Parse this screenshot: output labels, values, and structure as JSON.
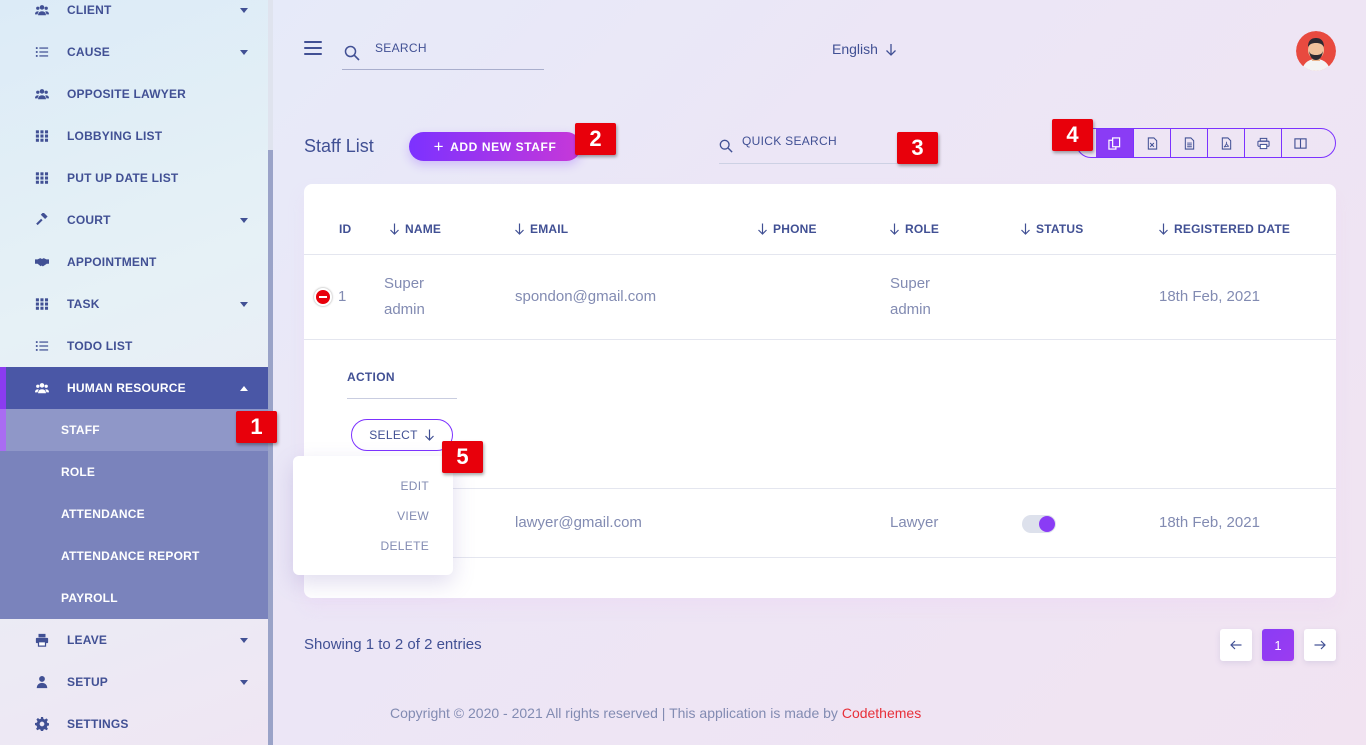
{
  "sidebar": {
    "items": [
      {
        "label": "CLIENT",
        "icon": "users-icon",
        "has_caret": true
      },
      {
        "label": "CAUSE",
        "icon": "list-icon",
        "has_caret": true
      },
      {
        "label": "OPPOSITE LAWYER",
        "icon": "users-icon",
        "has_caret": false
      },
      {
        "label": "LOBBYING LIST",
        "icon": "grid-icon",
        "has_caret": false
      },
      {
        "label": "PUT UP DATE LIST",
        "icon": "grid-icon",
        "has_caret": false
      },
      {
        "label": "COURT",
        "icon": "gavel-icon",
        "has_caret": true
      },
      {
        "label": "APPOINTMENT",
        "icon": "handshake-icon",
        "has_caret": false
      },
      {
        "label": "TASK",
        "icon": "grid-icon",
        "has_caret": true
      },
      {
        "label": "TODO LIST",
        "icon": "list-icon",
        "has_caret": false
      },
      {
        "label": "HUMAN RESOURCE",
        "icon": "users-icon",
        "has_caret": true,
        "active": true
      },
      {
        "label": "LEAVE",
        "icon": "printer-icon",
        "has_caret": true
      },
      {
        "label": "SETUP",
        "icon": "user-icon",
        "has_caret": true
      },
      {
        "label": "SETTINGS",
        "icon": "gear-icon",
        "has_caret": false
      }
    ],
    "subitems": [
      {
        "label": "STAFF",
        "active": true
      },
      {
        "label": "ROLE"
      },
      {
        "label": "ATTENDANCE"
      },
      {
        "label": "ATTENDANCE REPORT"
      },
      {
        "label": "PAYROLL"
      }
    ]
  },
  "markers": [
    "1",
    "2",
    "3",
    "4",
    "5"
  ],
  "header": {
    "search_placeholder": "SEARCH",
    "language": "English"
  },
  "page": {
    "title": "Staff List",
    "add_button": "ADD NEW STAFF",
    "quick_search_placeholder": "QUICK SEARCH",
    "export_buttons": [
      "copy-icon",
      "excel-icon",
      "csv-icon",
      "pdf-icon",
      "print-icon",
      "columns-icon"
    ]
  },
  "table": {
    "columns": [
      "ID",
      "NAME",
      "EMAIL",
      "PHONE",
      "ROLE",
      "STATUS",
      "REGISTERED DATE"
    ],
    "rows": [
      {
        "id": "1",
        "name_line1": "Super",
        "name_line2": "admin",
        "email": "spondon@gmail.com",
        "phone": "",
        "role_line1": "Super",
        "role_line2": "admin",
        "status": "",
        "date": "18th Feb, 2021"
      },
      {
        "id": "",
        "name": "",
        "email": "lawyer@gmail.com",
        "phone": "",
        "role": "Lawyer",
        "status": "on",
        "date": "18th Feb, 2021"
      }
    ],
    "action_label": "ACTION",
    "select_label": "SELECT",
    "dropdown": [
      "EDIT",
      "VIEW",
      "DELETE"
    ]
  },
  "footer": {
    "entries": "Showing 1 to 2 of 2 entries",
    "current_page": "1",
    "copyright_text": "Copyright © 2020 - 2021 All rights reserved | This application is made by ",
    "brand": "Codethemes"
  },
  "colors": {
    "accent": "#7c32ff",
    "primary_text": "#415094",
    "marker": "#e8000b",
    "sidebar_active": "#4a57a6"
  }
}
